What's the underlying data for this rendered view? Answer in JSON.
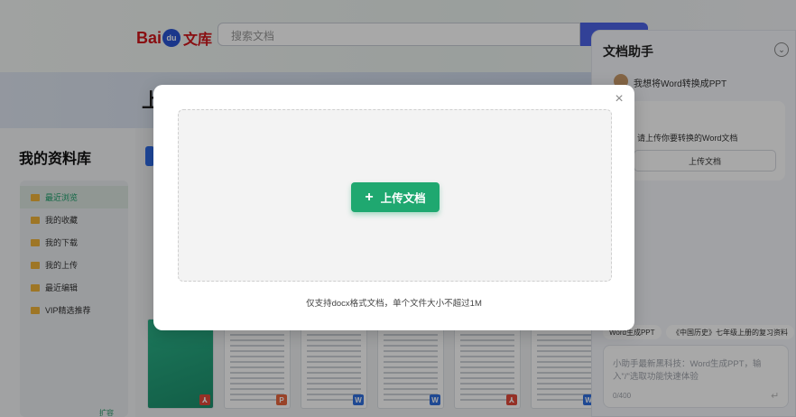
{
  "header": {
    "logo_main": "Bai",
    "logo_paw": "du",
    "logo_sub": "文库",
    "search_placeholder": "搜索文档"
  },
  "banner": {
    "text": "上"
  },
  "library": {
    "title": "我的资料库",
    "nav_items": [
      {
        "label": "最近浏览",
        "active": true
      },
      {
        "label": "我的收藏"
      },
      {
        "label": "我的下载"
      },
      {
        "label": "我的上传"
      },
      {
        "label": "最近编辑"
      },
      {
        "label": "VIP精选推荐"
      }
    ],
    "footer_text": "扩容"
  },
  "thumbnails": [
    {
      "type": "pdf",
      "badge": "⅄"
    },
    {
      "type": "ppt",
      "badge": "P"
    },
    {
      "type": "doc",
      "badge": "W"
    },
    {
      "type": "doc",
      "badge": "W"
    },
    {
      "type": "pdf",
      "badge": "⅄"
    },
    {
      "type": "doc",
      "badge": "W"
    }
  ],
  "assistant": {
    "title": "文档助手",
    "user_prompt": "我想将Word转换成PPT",
    "card_text": "请上传你要转换的Word文档",
    "card_button": "上传文档",
    "chips": [
      "Word生成PPT",
      "《中国历史》七年级上册的复习资料"
    ],
    "input_placeholder": "小助手最新黑科技：Word生成PPT，输入\"/\"选取功能快速体验",
    "counter": "0/400"
  },
  "modal": {
    "upload_button": "上传文档",
    "hint": "仅支持docx格式文档，单个文件大小不超过1M"
  },
  "colors": {
    "accent": "#1fa870",
    "brand_red": "#d0161b",
    "brand_blue": "#2a54d4"
  }
}
